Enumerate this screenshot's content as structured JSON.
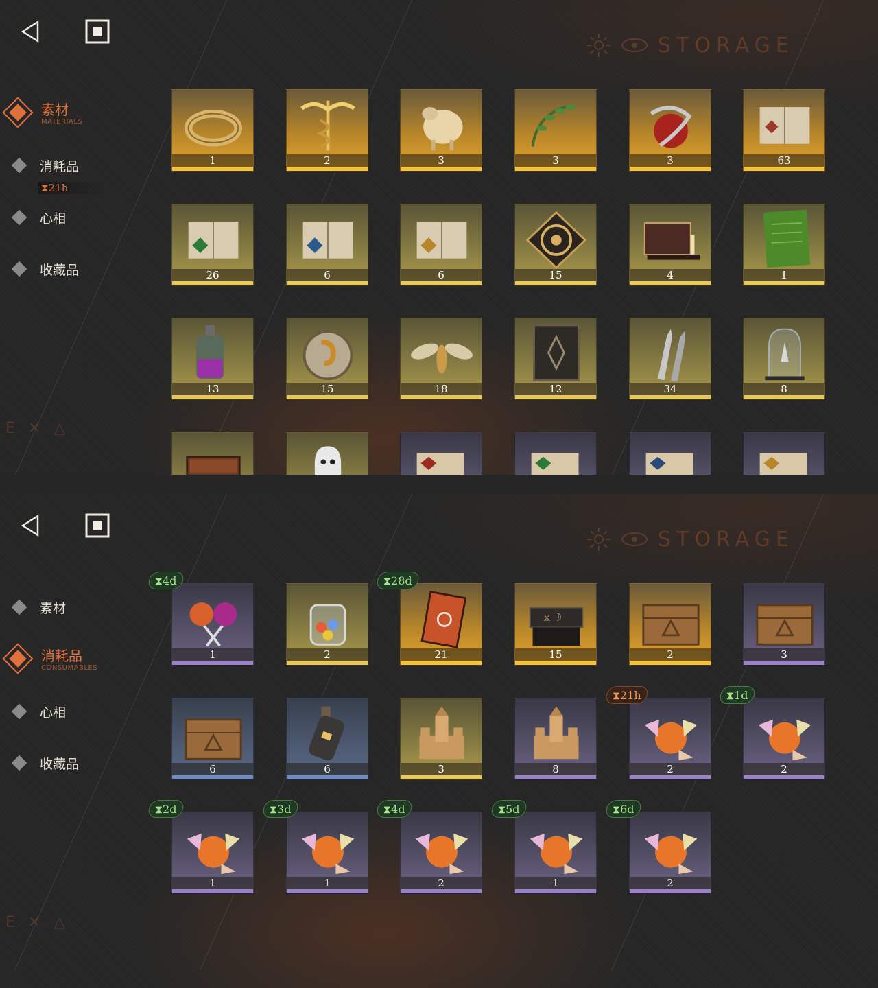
{
  "ui": {
    "back_icon": "back-triangle-icon",
    "home_icon": "square-stop-icon",
    "header_word": "STORAGE",
    "hourglass_glyph": "⧗"
  },
  "panel1": {
    "nav": {
      "active": {
        "label": "素材",
        "sub": "MATERIALS"
      },
      "items": [
        {
          "label": "消耗品",
          "timer": "21h"
        },
        {
          "label": "心相"
        },
        {
          "label": "收藏品"
        }
      ]
    },
    "rows": [
      [
        {
          "qty": "1",
          "tier": "gold",
          "art": "ring"
        },
        {
          "qty": "2",
          "tier": "gold",
          "art": "caduceus"
        },
        {
          "qty": "3",
          "tier": "gold",
          "art": "sheep"
        },
        {
          "qty": "3",
          "tier": "gold",
          "art": "laurel"
        },
        {
          "qty": "3",
          "tier": "gold",
          "art": "apple"
        },
        {
          "qty": "63",
          "tier": "gold",
          "art": "book-red"
        }
      ],
      [
        {
          "qty": "26",
          "tier": "yellow",
          "art": "book-green"
        },
        {
          "qty": "6",
          "tier": "yellow",
          "art": "book-blue"
        },
        {
          "qty": "6",
          "tier": "yellow",
          "art": "book-gold"
        },
        {
          "qty": "15",
          "tier": "yellow",
          "art": "clockwork"
        },
        {
          "qty": "4",
          "tier": "yellow",
          "art": "ouija"
        },
        {
          "qty": "1",
          "tier": "yellow",
          "art": "green-tome"
        }
      ],
      [
        {
          "qty": "13",
          "tier": "yellow",
          "art": "bottle"
        },
        {
          "qty": "15",
          "tier": "yellow",
          "art": "dial"
        },
        {
          "qty": "18",
          "tier": "yellow",
          "art": "moth"
        },
        {
          "qty": "12",
          "tier": "yellow",
          "art": "dark-book"
        },
        {
          "qty": "34",
          "tier": "yellow",
          "art": "bullets"
        },
        {
          "qty": "8",
          "tier": "yellow",
          "art": "bell-jar"
        }
      ],
      [
        {
          "qty": "",
          "tier": "yellow",
          "art": "chest"
        },
        {
          "qty": "",
          "tier": "yellow",
          "art": "ghost"
        },
        {
          "qty": "",
          "tier": "purple",
          "art": "scroll-red"
        },
        {
          "qty": "",
          "tier": "purple",
          "art": "scroll-green"
        },
        {
          "qty": "",
          "tier": "purple",
          "art": "scroll-blue"
        },
        {
          "qty": "",
          "tier": "purple",
          "art": "scroll-gold"
        }
      ]
    ]
  },
  "panel2": {
    "nav": {
      "items_before": [
        {
          "label": "素材"
        }
      ],
      "active": {
        "label": "消耗品",
        "sub": "CONSUMABLES"
      },
      "items_after": [
        {
          "label": "心相"
        },
        {
          "label": "收藏品"
        }
      ]
    },
    "rows": [
      [
        {
          "qty": "1",
          "tier": "purple",
          "art": "lollipops",
          "timer": "4d",
          "timer_color": "green"
        },
        {
          "qty": "2",
          "tier": "yellow",
          "art": "candy-jar"
        },
        {
          "qty": "21",
          "tier": "gold",
          "art": "rune-book",
          "timer": "28d",
          "timer_color": "green"
        },
        {
          "qty": "15",
          "tier": "gold",
          "art": "rune-table"
        },
        {
          "qty": "2",
          "tier": "gold",
          "art": "crate"
        },
        {
          "qty": "3",
          "tier": "purple",
          "art": "crate"
        }
      ],
      [
        {
          "qty": "6",
          "tier": "blue",
          "art": "crate"
        },
        {
          "qty": "6",
          "tier": "blue",
          "art": "message-bottle"
        },
        {
          "qty": "3",
          "tier": "yellow",
          "art": "sandcastle"
        },
        {
          "qty": "8",
          "tier": "purple",
          "art": "sandcastle"
        },
        {
          "qty": "2",
          "tier": "purple",
          "art": "candies",
          "timer": "21h",
          "timer_color": "orange"
        },
        {
          "qty": "2",
          "tier": "purple",
          "art": "candies",
          "timer": "1d",
          "timer_color": "green"
        }
      ],
      [
        {
          "qty": "1",
          "tier": "purple",
          "art": "candies",
          "timer": "2d",
          "timer_color": "green"
        },
        {
          "qty": "1",
          "tier": "purple",
          "art": "candies",
          "timer": "3d",
          "timer_color": "green"
        },
        {
          "qty": "2",
          "tier": "purple",
          "art": "candies",
          "timer": "4d",
          "timer_color": "green"
        },
        {
          "qty": "1",
          "tier": "purple",
          "art": "candies",
          "timer": "5d",
          "timer_color": "green"
        },
        {
          "qty": "2",
          "tier": "purple",
          "art": "candies",
          "timer": "6d",
          "timer_color": "green"
        }
      ]
    ]
  }
}
